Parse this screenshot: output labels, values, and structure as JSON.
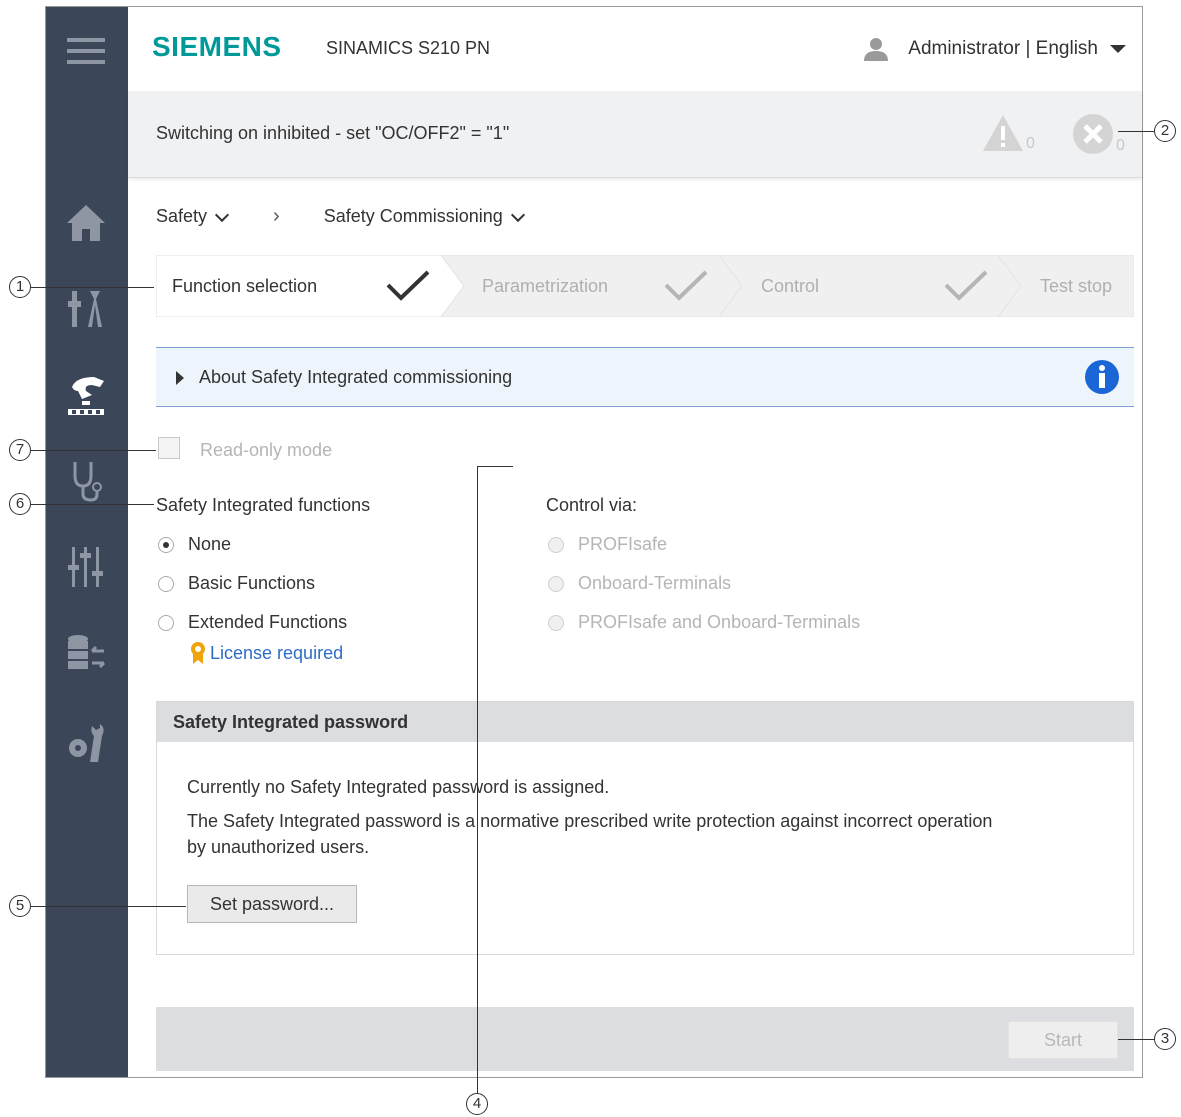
{
  "header": {
    "brand": "SIEMENS",
    "product": "SINAMICS S210 PN",
    "user": "Administrator | English"
  },
  "status": {
    "message": "Switching on inhibited - set \"OC/OFF2\" = \"1\"",
    "warnings": "0",
    "errors": "0"
  },
  "breadcrumb": {
    "items": [
      "Safety",
      "Safety Commissioning"
    ],
    "separator": "›"
  },
  "steps": [
    {
      "label": "Function selection",
      "active": true
    },
    {
      "label": "Parametrization",
      "active": false
    },
    {
      "label": "Control",
      "active": false
    },
    {
      "label": "Test stop",
      "active": false
    }
  ],
  "about": {
    "label": "About Safety Integrated commissioning"
  },
  "readonly": {
    "label": "Read-only mode"
  },
  "functions": {
    "title": "Safety Integrated functions",
    "options": [
      "None",
      "Basic Functions",
      "Extended Functions"
    ],
    "selected": "None",
    "license": "License required"
  },
  "control": {
    "title": "Control via:",
    "options": [
      "PROFIsafe",
      "Onboard-Terminals",
      "PROFIsafe and Onboard-Terminals"
    ]
  },
  "password": {
    "title": "Safety Integrated password",
    "line1": "Currently no Safety Integrated password is assigned.",
    "line2": "The Safety Integrated password is a normative prescribed write protection against incorrect operation",
    "line3": "by unauthorized users.",
    "button": "Set password..."
  },
  "footer": {
    "start": "Start"
  },
  "callouts": [
    "1",
    "2",
    "3",
    "4",
    "5",
    "6",
    "7"
  ],
  "colors": {
    "sidebar": "#3b4658",
    "brand": "#009999",
    "info": "#1a66d6",
    "license_icon": "#f0a30a"
  }
}
